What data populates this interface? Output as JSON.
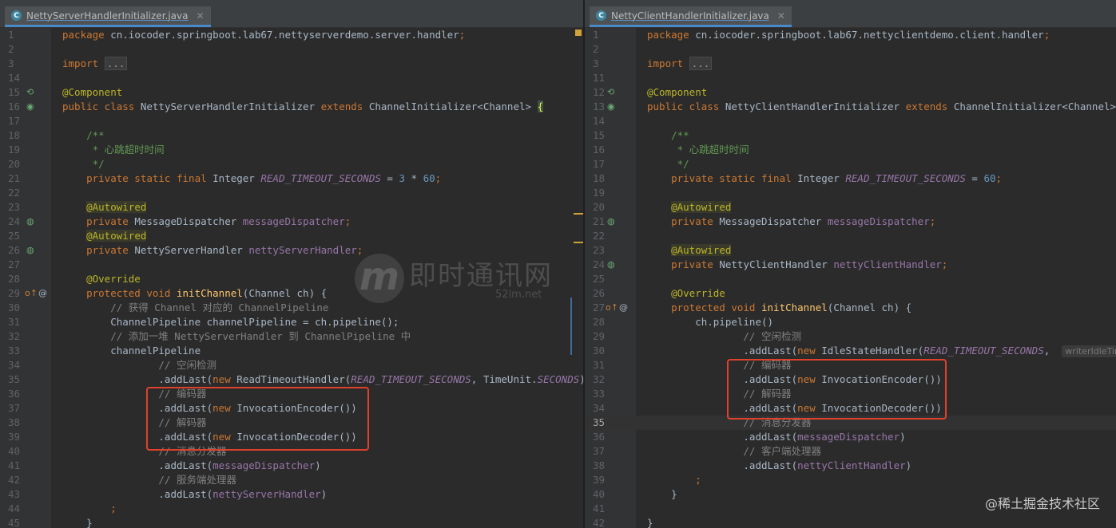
{
  "left": {
    "tab": {
      "icon_letter": "C",
      "filename": "NettyServerHandlerInitializer.java",
      "close": "✕"
    },
    "lines": [
      {
        "n": "1",
        "tokens": [
          {
            "t": "package ",
            "c": "kw"
          },
          {
            "t": "cn.iocoder.springboot.lab67.nettyserverdemo.server.handler"
          },
          {
            "t": ";",
            "c": "kw"
          }
        ]
      },
      {
        "n": "2",
        "tokens": []
      },
      {
        "n": "3",
        "tokens": [
          {
            "t": "import ",
            "c": "kw"
          },
          {
            "t": "...",
            "c": "fold"
          }
        ]
      },
      {
        "n": "14",
        "tokens": []
      },
      {
        "n": "15",
        "tokens": [
          {
            "t": "@Component",
            "c": "ann"
          }
        ]
      },
      {
        "n": "16",
        "tokens": [
          {
            "t": "public class ",
            "c": "kw"
          },
          {
            "t": "NettyServerHandlerInitializer "
          },
          {
            "t": "extends ",
            "c": "kw"
          },
          {
            "t": "ChannelInitializer<Channel> "
          },
          {
            "t": "{",
            "c": "brace-hl"
          }
        ]
      },
      {
        "n": "17",
        "tokens": []
      },
      {
        "n": "18",
        "tokens": [
          {
            "t": "    /**",
            "c": "doc"
          }
        ]
      },
      {
        "n": "19",
        "tokens": [
          {
            "t": "     * 心跳超时时间",
            "c": "doc"
          }
        ]
      },
      {
        "n": "20",
        "tokens": [
          {
            "t": "     */",
            "c": "doc"
          }
        ]
      },
      {
        "n": "21",
        "tokens": [
          {
            "t": "    private static final ",
            "c": "kw"
          },
          {
            "t": "Integer "
          },
          {
            "t": "READ_TIMEOUT_SECONDS",
            "c": "fld"
          },
          {
            "t": " = "
          },
          {
            "t": "3",
            "c": "num"
          },
          {
            "t": " * "
          },
          {
            "t": "60",
            "c": "num"
          },
          {
            "t": ";",
            "c": "kw"
          }
        ]
      },
      {
        "n": "22",
        "tokens": []
      },
      {
        "n": "23",
        "tokens": [
          {
            "t": "    "
          },
          {
            "t": "@Autowired",
            "c": "ann-hl"
          }
        ]
      },
      {
        "n": "24",
        "tokens": [
          {
            "t": "    private ",
            "c": "kw"
          },
          {
            "t": "MessageDispatcher "
          },
          {
            "t": "messageDispatcher",
            "c": "ivar"
          },
          {
            "t": ";",
            "c": "kw"
          }
        ]
      },
      {
        "n": "25",
        "tokens": [
          {
            "t": "    "
          },
          {
            "t": "@Autowired",
            "c": "ann-hl"
          }
        ]
      },
      {
        "n": "26",
        "tokens": [
          {
            "t": "    private ",
            "c": "kw"
          },
          {
            "t": "NettyServerHandler "
          },
          {
            "t": "nettyServerHandler",
            "c": "ivar"
          },
          {
            "t": ";",
            "c": "kw"
          }
        ]
      },
      {
        "n": "27",
        "tokens": []
      },
      {
        "n": "28",
        "tokens": [
          {
            "t": "    @Override",
            "c": "ann"
          }
        ]
      },
      {
        "n": "29",
        "tokens": [
          {
            "t": "    protected void ",
            "c": "kw"
          },
          {
            "t": "initChannel",
            "c": "fn"
          },
          {
            "t": "(Channel ch) {"
          }
        ]
      },
      {
        "n": "30",
        "tokens": [
          {
            "t": "        // 获得 Channel 对应的 ChannelPipeline",
            "c": "cmt"
          }
        ]
      },
      {
        "n": "31",
        "tokens": [
          {
            "t": "        ChannelPipeline channelPipeline = ch.pipeline();"
          }
        ]
      },
      {
        "n": "32",
        "tokens": [
          {
            "t": "        // 添加一堆 NettyServerHandler 到 ChannelPipeline 中",
            "c": "cmt"
          }
        ]
      },
      {
        "n": "33",
        "tokens": [
          {
            "t": "        channelPipeline"
          }
        ]
      },
      {
        "n": "34",
        "tokens": [
          {
            "t": "                // 空闲检测",
            "c": "cmt"
          }
        ]
      },
      {
        "n": "35",
        "tokens": [
          {
            "t": "                .addLast("
          },
          {
            "t": "new ",
            "c": "kw"
          },
          {
            "t": "ReadTimeoutHandler("
          },
          {
            "t": "READ_TIMEOUT_SECONDS",
            "c": "fld"
          },
          {
            "t": ", TimeUnit."
          },
          {
            "t": "SECONDS",
            "c": "fld"
          },
          {
            "t": "))"
          }
        ]
      },
      {
        "n": "36",
        "tokens": [
          {
            "t": "                // 编码器",
            "c": "cmt"
          }
        ]
      },
      {
        "n": "37",
        "tokens": [
          {
            "t": "                .addLast("
          },
          {
            "t": "new ",
            "c": "kw"
          },
          {
            "t": "InvocationEncoder())"
          }
        ]
      },
      {
        "n": "38",
        "tokens": [
          {
            "t": "                // 解码器",
            "c": "cmt"
          }
        ]
      },
      {
        "n": "39",
        "tokens": [
          {
            "t": "                .addLast("
          },
          {
            "t": "new ",
            "c": "kw"
          },
          {
            "t": "InvocationDecoder())"
          }
        ]
      },
      {
        "n": "40",
        "tokens": [
          {
            "t": "                // 消息分发器",
            "c": "cmt"
          }
        ]
      },
      {
        "n": "41",
        "tokens": [
          {
            "t": "                .addLast("
          },
          {
            "t": "messageDispatcher",
            "c": "ivar"
          },
          {
            "t": ")"
          }
        ]
      },
      {
        "n": "42",
        "tokens": [
          {
            "t": "                // 服务端处理器",
            "c": "cmt"
          }
        ]
      },
      {
        "n": "43",
        "tokens": [
          {
            "t": "                .addLast("
          },
          {
            "t": "nettyServerHandler",
            "c": "ivar"
          },
          {
            "t": ")"
          }
        ]
      },
      {
        "n": "44",
        "tokens": [
          {
            "t": "        ;",
            "c": "kw"
          }
        ]
      },
      {
        "n": "45",
        "tokens": [
          {
            "t": "    }"
          }
        ]
      }
    ]
  },
  "right": {
    "tab": {
      "icon_letter": "C",
      "filename": "NettyClientHandlerInitializer.java",
      "close": "✕"
    },
    "lines": [
      {
        "n": "1",
        "tokens": [
          {
            "t": "package ",
            "c": "kw"
          },
          {
            "t": "cn.iocoder.springboot.lab67.nettyclientdemo.client.handler"
          },
          {
            "t": ";",
            "c": "kw"
          }
        ]
      },
      {
        "n": "2",
        "tokens": []
      },
      {
        "n": "3",
        "tokens": [
          {
            "t": "import ",
            "c": "kw"
          },
          {
            "t": "...",
            "c": "fold"
          }
        ]
      },
      {
        "n": "11",
        "tokens": []
      },
      {
        "n": "12",
        "tokens": [
          {
            "t": "@Component",
            "c": "ann"
          }
        ]
      },
      {
        "n": "13",
        "tokens": [
          {
            "t": "public class ",
            "c": "kw"
          },
          {
            "t": "NettyClientHandlerInitializer "
          },
          {
            "t": "extends ",
            "c": "kw"
          },
          {
            "t": "ChannelInitializer<Channel> {"
          }
        ]
      },
      {
        "n": "14",
        "tokens": []
      },
      {
        "n": "15",
        "tokens": [
          {
            "t": "    /**",
            "c": "doc"
          }
        ]
      },
      {
        "n": "16",
        "tokens": [
          {
            "t": "     * 心跳超时时间",
            "c": "doc"
          }
        ]
      },
      {
        "n": "17",
        "tokens": [
          {
            "t": "     */",
            "c": "doc"
          }
        ]
      },
      {
        "n": "18",
        "tokens": [
          {
            "t": "    private static final ",
            "c": "kw"
          },
          {
            "t": "Integer "
          },
          {
            "t": "READ_TIMEOUT_SECONDS",
            "c": "fld"
          },
          {
            "t": " = "
          },
          {
            "t": "60",
            "c": "num"
          },
          {
            "t": ";",
            "c": "kw"
          }
        ]
      },
      {
        "n": "19",
        "tokens": []
      },
      {
        "n": "20",
        "tokens": [
          {
            "t": "    "
          },
          {
            "t": "@Autowired",
            "c": "ann-hl"
          }
        ]
      },
      {
        "n": "21",
        "tokens": [
          {
            "t": "    private ",
            "c": "kw"
          },
          {
            "t": "MessageDispatcher "
          },
          {
            "t": "messageDispatcher",
            "c": "ivar"
          },
          {
            "t": ";",
            "c": "kw"
          }
        ]
      },
      {
        "n": "22",
        "tokens": []
      },
      {
        "n": "23",
        "tokens": [
          {
            "t": "    "
          },
          {
            "t": "@Autowired",
            "c": "ann-hl"
          }
        ]
      },
      {
        "n": "24",
        "tokens": [
          {
            "t": "    private ",
            "c": "kw"
          },
          {
            "t": "NettyClientHandler "
          },
          {
            "t": "nettyClientHandler",
            "c": "ivar"
          },
          {
            "t": ";",
            "c": "kw"
          }
        ]
      },
      {
        "n": "25",
        "tokens": []
      },
      {
        "n": "26",
        "tokens": [
          {
            "t": "    @Override",
            "c": "ann"
          }
        ]
      },
      {
        "n": "27",
        "tokens": [
          {
            "t": "    protected void ",
            "c": "kw"
          },
          {
            "t": "initChannel",
            "c": "fn"
          },
          {
            "t": "(Channel ch) {"
          }
        ]
      },
      {
        "n": "28",
        "tokens": [
          {
            "t": "        ch.pipeline()"
          }
        ]
      },
      {
        "n": "29",
        "tokens": [
          {
            "t": "                // 空闲检测",
            "c": "cmt"
          }
        ]
      },
      {
        "n": "30",
        "tokens": [
          {
            "t": "                .addLast("
          },
          {
            "t": "new ",
            "c": "kw"
          },
          {
            "t": "IdleStateHandler("
          },
          {
            "t": "READ_TIMEOUT_SECONDS",
            "c": "fld"
          },
          {
            "t": ",  "
          },
          {
            "t": "writerIdleTimeSeconds",
            "c": "hint"
          }
        ]
      },
      {
        "n": "31",
        "tokens": [
          {
            "t": "                // 编码器",
            "c": "cmt"
          }
        ]
      },
      {
        "n": "32",
        "tokens": [
          {
            "t": "                .addLast("
          },
          {
            "t": "new ",
            "c": "kw"
          },
          {
            "t": "InvocationEncoder())"
          }
        ]
      },
      {
        "n": "33",
        "tokens": [
          {
            "t": "                // 解码器",
            "c": "cmt"
          }
        ]
      },
      {
        "n": "34",
        "tokens": [
          {
            "t": "                .addLast("
          },
          {
            "t": "new ",
            "c": "kw"
          },
          {
            "t": "InvocationDecoder())"
          }
        ]
      },
      {
        "n": "35",
        "tokens": [
          {
            "t": "                // 消息分发器",
            "c": "cmt"
          }
        ]
      },
      {
        "n": "36",
        "tokens": [
          {
            "t": "                .addLast("
          },
          {
            "t": "messageDispatcher",
            "c": "ivar"
          },
          {
            "t": ")"
          }
        ]
      },
      {
        "n": "37",
        "tokens": [
          {
            "t": "                // 客户端处理器",
            "c": "cmt"
          }
        ]
      },
      {
        "n": "38",
        "tokens": [
          {
            "t": "                .addLast("
          },
          {
            "t": "nettyClientHandler",
            "c": "ivar"
          },
          {
            "t": ")"
          }
        ]
      },
      {
        "n": "39",
        "tokens": [
          {
            "t": "        ;",
            "c": "kw"
          }
        ]
      },
      {
        "n": "40",
        "tokens": [
          {
            "t": "    }"
          }
        ]
      },
      {
        "n": "41",
        "tokens": []
      },
      {
        "n": "42",
        "tokens": [
          {
            "t": "}"
          }
        ]
      }
    ],
    "current_line": "35"
  },
  "watermark": {
    "logo_letter": "m",
    "name": "即时通讯网",
    "site": "52im.net"
  },
  "attribution": "@稀土掘金技术社区",
  "colors": {
    "background": "#2b2b2b",
    "keyword": "#cc7832",
    "annotation": "#bbb529",
    "comment": "#808080",
    "field": "#9876aa",
    "number": "#6897bb",
    "method": "#ffc66d",
    "highlight_box": "#e0412b"
  }
}
